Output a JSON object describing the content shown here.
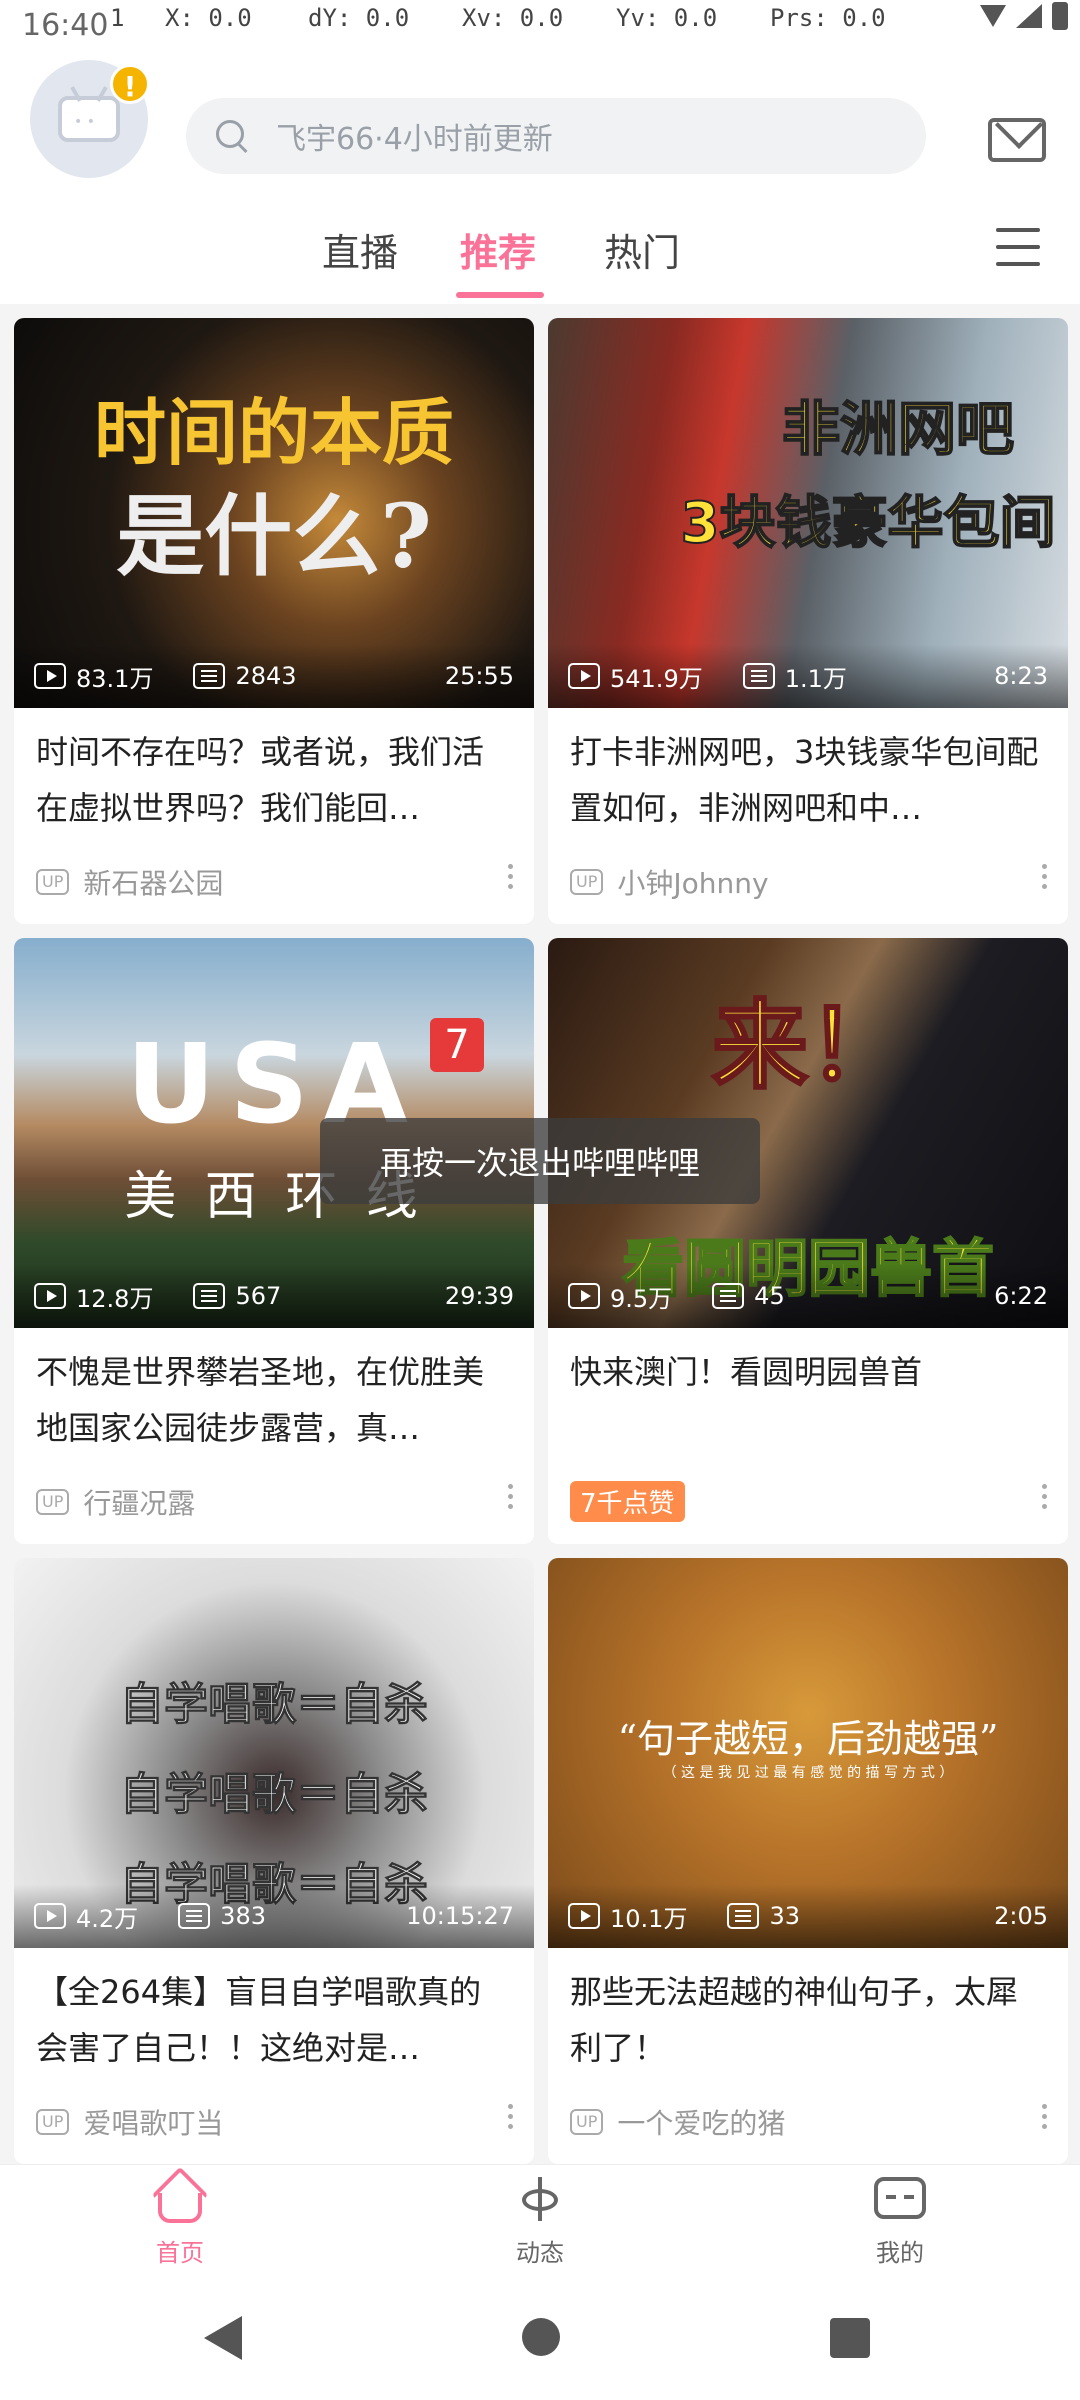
{
  "status": {
    "time": "16:40",
    "debug_prefix": "1",
    "dx": "X: 0.0",
    "dy": "dY: 0.0",
    "xv": "Xv: 0.0",
    "yv": "Yv: 0.0",
    "prs": "Prs: 0.0"
  },
  "header": {
    "search_placeholder": "飞宇66·4小时前更新",
    "avatar_badge": "!"
  },
  "tabs": [
    {
      "label": "直播"
    },
    {
      "label": "推荐"
    },
    {
      "label": "热门"
    }
  ],
  "cards": [
    {
      "thumb_text_1": "时间的本质",
      "thumb_text_2": "是什么?",
      "views": "83.1万",
      "danmaku": "2843",
      "duration": "25:55",
      "title": "时间不存在吗？或者说，我们活在虚拟世界吗？我们能回…",
      "up_badge": "UP",
      "author": "新石器公园"
    },
    {
      "thumb_text_1": "非洲网吧",
      "thumb_text_2": "3块钱豪华包间",
      "views": "541.9万",
      "danmaku": "1.1万",
      "duration": "8:23",
      "title": "打卡非洲网吧，3块钱豪华包间配置如何，非洲网吧和中…",
      "up_badge": "UP",
      "author": "小钟Johnny"
    },
    {
      "thumb_text_1": "USA",
      "thumb_text_2": "美 西 环 线",
      "thumb_badge": "7",
      "views": "12.8万",
      "danmaku": "567",
      "duration": "29:39",
      "title": "不愧是世界攀岩圣地，在优胜美地国家公园徒步露营，真…",
      "up_badge": "UP",
      "author": "行疆况露"
    },
    {
      "thumb_text_1": "来！",
      "thumb_text_2": "看圆明园兽首",
      "views": "9.5万",
      "danmaku": "45",
      "duration": "6:22",
      "title": "快来澳门！看圆明园兽首",
      "likes_badge": "7千点赞"
    },
    {
      "thumb_text_1": "自学唱歌＝自杀",
      "thumb_text_2": "自学唱歌＝自杀",
      "thumb_text_3": "自学唱歌＝自杀",
      "views": "4.2万",
      "danmaku": "383",
      "duration": "10:15:27",
      "title": "【全264集】盲目自学唱歌真的会害了自己！！这绝对是…",
      "up_badge": "UP",
      "author": "爱唱歌叮当"
    },
    {
      "thumb_text_1": "“句子越短，后劲越强”",
      "thumb_text_2": "（ 这 是 我 见 过 最 有 感 觉 的 描 写 方 式 ）",
      "views": "10.1万",
      "danmaku": "33",
      "duration": "2:05",
      "title": "那些无法超越的神仙句子，太犀利了！",
      "up_badge": "UP",
      "author": "一个爱吃的猪"
    }
  ],
  "toast": "再按一次退出哔哩哔哩",
  "bottom_nav": [
    {
      "label": "首页"
    },
    {
      "label": "动态"
    },
    {
      "label": "我的"
    }
  ],
  "colors": {
    "accent": "#fb7299",
    "likes": "#ff8c4a"
  }
}
